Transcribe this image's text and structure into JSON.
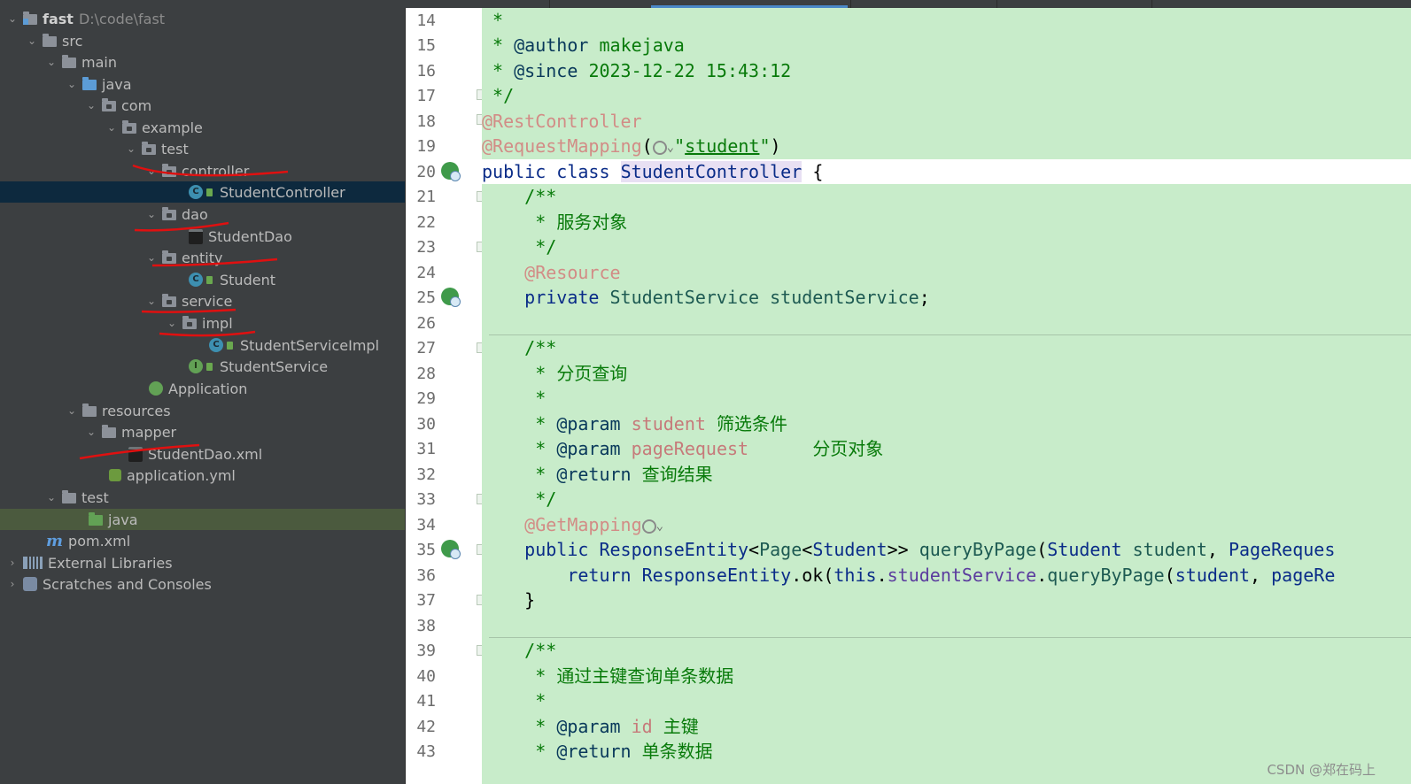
{
  "project_tree": {
    "root_name": "fast",
    "root_path": "D:\\code\\fast",
    "nodes": [
      {
        "label": "src",
        "type": "folder"
      },
      {
        "label": "main",
        "type": "folder"
      },
      {
        "label": "java",
        "type": "source-folder"
      },
      {
        "label": "com",
        "type": "package"
      },
      {
        "label": "example",
        "type": "package"
      },
      {
        "label": "test",
        "type": "package"
      },
      {
        "label": "controller",
        "type": "package"
      },
      {
        "label": "StudentController",
        "type": "class"
      },
      {
        "label": "dao",
        "type": "package"
      },
      {
        "label": "StudentDao",
        "type": "interface-file"
      },
      {
        "label": "entity",
        "type": "package"
      },
      {
        "label": "Student",
        "type": "class"
      },
      {
        "label": "service",
        "type": "package"
      },
      {
        "label": "impl",
        "type": "package"
      },
      {
        "label": "StudentServiceImpl",
        "type": "class"
      },
      {
        "label": "StudentService",
        "type": "interface"
      },
      {
        "label": "Application",
        "type": "application"
      },
      {
        "label": "resources",
        "type": "resource-folder"
      },
      {
        "label": "mapper",
        "type": "folder"
      },
      {
        "label": "StudentDao.xml",
        "type": "xml"
      },
      {
        "label": "application.yml",
        "type": "yml"
      },
      {
        "label": "test",
        "type": "folder"
      },
      {
        "label": "java",
        "type": "test-source-folder"
      },
      {
        "label": "pom.xml",
        "type": "maven"
      },
      {
        "label": "External Libraries",
        "type": "libraries"
      },
      {
        "label": "Scratches and Consoles",
        "type": "scratches"
      }
    ],
    "selected": "StudentController"
  },
  "editor": {
    "line_numbers": [
      "14",
      "15",
      "16",
      "17",
      "18",
      "19",
      "20",
      "21",
      "22",
      "23",
      "24",
      "25",
      "26",
      "27",
      "28",
      "29",
      "30",
      "31",
      "32",
      "33",
      "34",
      "35",
      "36",
      "37",
      "38",
      "39",
      "40",
      "41",
      "42",
      "43"
    ],
    "comment": {
      "star": "*",
      "author_tag": "@author",
      "author": "makejava",
      "since_tag": "@since",
      "since": "2023-12-22 15:43:12",
      "end": "*/",
      "open": "/**",
      "service_obj": "服务对象",
      "page_query": "分页查询",
      "param_tag": "@param",
      "param_student": "student",
      "filter": "筛选条件",
      "param_page": "pageRequest",
      "page_obj": "分页对象",
      "return_tag": "@return",
      "query_result": "查询结果",
      "by_id": "通过主键查询单条数据",
      "param_id": "id",
      "pk": "主键",
      "single": "单条数据"
    },
    "code": {
      "rest_controller": "@RestController",
      "request_mapping": "@RequestMapping",
      "mapping_value": "student",
      "public": "public",
      "class": "class",
      "class_name": "StudentController",
      "open_brace": "{",
      "resource": "@Resource",
      "private": "private",
      "service_type": "StudentService",
      "service_field": "studentService",
      "get_mapping": "@GetMapping",
      "response_entity": "ResponseEntity",
      "page_type": "Page",
      "student_type": "Student",
      "method": "queryByPage",
      "student_param": "student",
      "page_request_type": "PageReques",
      "return": "return",
      "ok": "ok",
      "this": "this",
      "page_request_arg": "pageRe",
      "close_brace": "}"
    }
  },
  "watermark": "CSDN @郑在码上"
}
